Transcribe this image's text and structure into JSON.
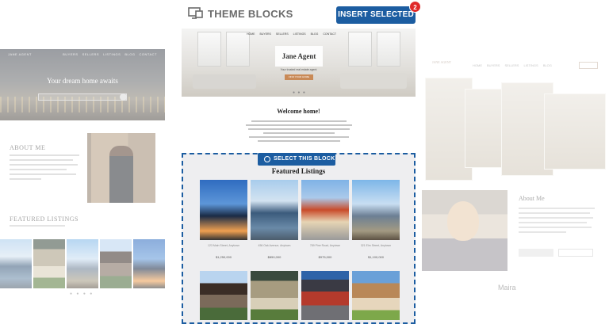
{
  "toolbar": {
    "title": "THEME BLOCKS",
    "insert_label": "INSERT SELECTED",
    "insert_count": "2"
  },
  "left_preview": {
    "brand": "JANE AGENT",
    "nav": [
      "BUYERS",
      "SELLERS",
      "LISTINGS",
      "BLOG",
      "CONTACT"
    ],
    "hero_title": "Your dream home awaits",
    "about_title": "ABOUT ME",
    "featured_title": "FEATURED LISTINGS"
  },
  "center_preview": {
    "brand": "Jane Agent",
    "tagline": "Your trusted real estate agent",
    "hero_button": "FIND YOUR HOME",
    "welcome_title": "Welcome home!",
    "select_label": "SELECT THIS BLOCK",
    "featured_title": "Featured Listings",
    "listings": [
      {
        "label": "123 Main Street, Anytown",
        "price": "$1,250,000"
      },
      {
        "label": "456 Oak Avenue, Anytown",
        "price": "$850,000"
      },
      {
        "label": "789 Pine Road, Anytown",
        "price": "$975,000"
      },
      {
        "label": "321 Elm Street, Anytown",
        "price": "$1,100,000"
      }
    ]
  },
  "right_preview": {
    "brand": "JANE AGENT",
    "nav": [
      "HOME",
      "BUYERS",
      "SELLERS",
      "LISTINGS",
      "BLOG"
    ],
    "about_title": "About Me",
    "name": "Maira"
  },
  "colors": {
    "accent": "#1c5da1",
    "badge": "#e02a2a"
  }
}
